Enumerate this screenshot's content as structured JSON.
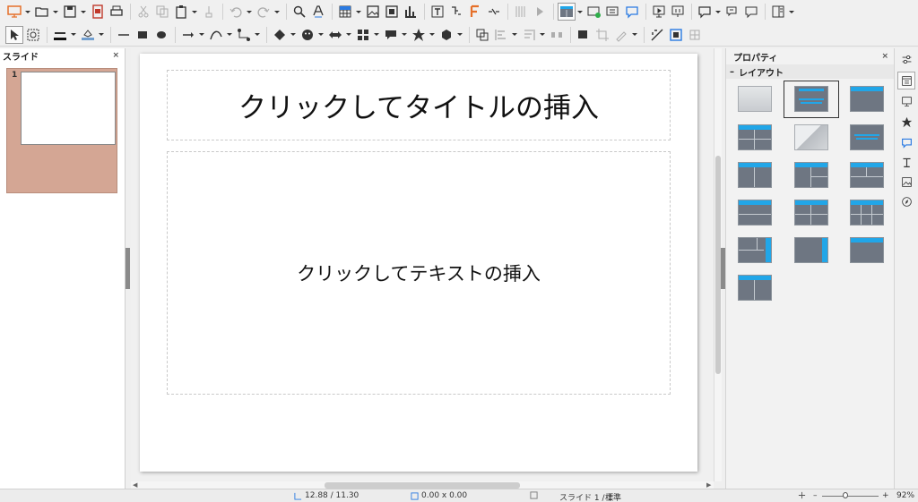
{
  "slide_pane": {
    "title": "スライド",
    "close_glyph": "×",
    "thumbnails": [
      {
        "number": "1"
      }
    ]
  },
  "slide": {
    "title_placeholder": "クリックしてタイトルの挿入",
    "body_placeholder": "クリックしてテキストの挿入"
  },
  "properties": {
    "title": "プロパティ",
    "close_glyph": "×",
    "layout_section": {
      "title": "レイアウト",
      "collapse_glyph": "–",
      "selected_index": 1
    }
  },
  "status_bar": {
    "position": "12.88 / 11.30",
    "size": "0.00 x 0.00",
    "slide": "スライド 1 / 1",
    "master": "標準",
    "zoom_minus": "–",
    "zoom_plus": "+",
    "zoom": "92%",
    "zoom_fraction": 0.42
  },
  "icons": {
    "toolbar1": [
      "presentation-icon",
      "open-folder-icon",
      "save-icon",
      "export-pdf-icon",
      "print-icon",
      "cut-icon",
      "copy-icon",
      "paste-icon",
      "clone-formatting-icon",
      "undo-icon",
      "redo-icon",
      "find-replace-icon",
      "spelling-icon",
      "table-icon",
      "image-icon",
      "media-icon",
      "chart-icon",
      "text-box-icon",
      "special-character-icon",
      "fontwork-icon",
      "hyperlink-icon",
      "grid-icon",
      "start-slideshow-icon",
      "slide-layout-icon",
      "new-slide-icon",
      "duplicate-slide-icon",
      "delete-slide-icon",
      "display-views-icon",
      "master-slide-icon",
      "comment-icon",
      "show-comments-icon",
      "sidebar-icon"
    ],
    "toolbar2": [
      "select-icon",
      "zoom-pan-icon",
      "line-color-icon",
      "fill-color-icon",
      "line-icon",
      "rectangle-icon",
      "ellipse-icon",
      "arrow-line-icon",
      "curve-icon",
      "connector-icon",
      "basic-shapes-icon",
      "symbol-shapes-icon",
      "block-arrows-icon",
      "flowchart-icon",
      "callouts-icon",
      "stars-icon",
      "3d-objects-icon",
      "rotate-icon",
      "align-icon",
      "arrange-icon",
      "distribute-icon",
      "shadow-icon",
      "crop-icon",
      "points-icon",
      "toggle-extrusion-icon",
      "glue-points-icon",
      "show-gluepoints-icon"
    ],
    "sidebar_tabs": [
      "sidebar-settings-icon",
      "properties-icon",
      "slide-transition-icon",
      "animation-icon",
      "master-slides-icon",
      "styles-icon",
      "gallery-icon",
      "navigator-icon"
    ]
  }
}
